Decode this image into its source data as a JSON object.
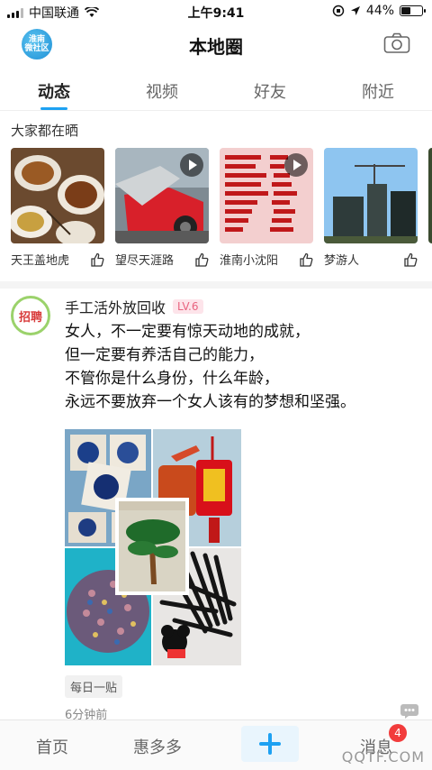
{
  "status_bar": {
    "carrier": "中国联通",
    "time": "上午9:41",
    "battery": "44%",
    "battery_level": 0.44
  },
  "header": {
    "logo_text": "淮南\n微社区",
    "title": "本地圈",
    "camera_icon": "camera-icon"
  },
  "tabs": [
    {
      "label": "动态",
      "active": true
    },
    {
      "label": "视频",
      "active": false
    },
    {
      "label": "好友",
      "active": false
    },
    {
      "label": "附近",
      "active": false
    }
  ],
  "section": {
    "title": "大家都在晒"
  },
  "stories": [
    {
      "name": "天王盖地虎",
      "has_video": false,
      "icon": "thumbs-up-icon"
    },
    {
      "name": "望尽天涯路",
      "has_video": true,
      "icon": "thumbs-up-icon"
    },
    {
      "name": "淮南小沈阳",
      "has_video": true,
      "icon": "thumbs-up-icon"
    },
    {
      "name": "梦游人",
      "has_video": false,
      "icon": "thumbs-up-icon"
    }
  ],
  "post": {
    "avatar_text": "招聘",
    "author": "手工活外放回收",
    "level": "LV.6",
    "lines": [
      "女人，不一定要有惊天动地的成就，",
      "但一定要有养活自己的能力，",
      "不管你是什么身份，什么年龄，",
      "永远不要放弃一个女人该有的梦想和坚强。"
    ],
    "tag": "每日一贴",
    "time": "6分钟前"
  },
  "bottom_nav": {
    "home": "首页",
    "deals": "惠多多",
    "messages": "消息",
    "message_count": "4"
  },
  "watermark": "QQTF.COM",
  "colors": {
    "accent": "#1da1f2",
    "badge": "#f23c3c",
    "level": "#e8637f"
  }
}
